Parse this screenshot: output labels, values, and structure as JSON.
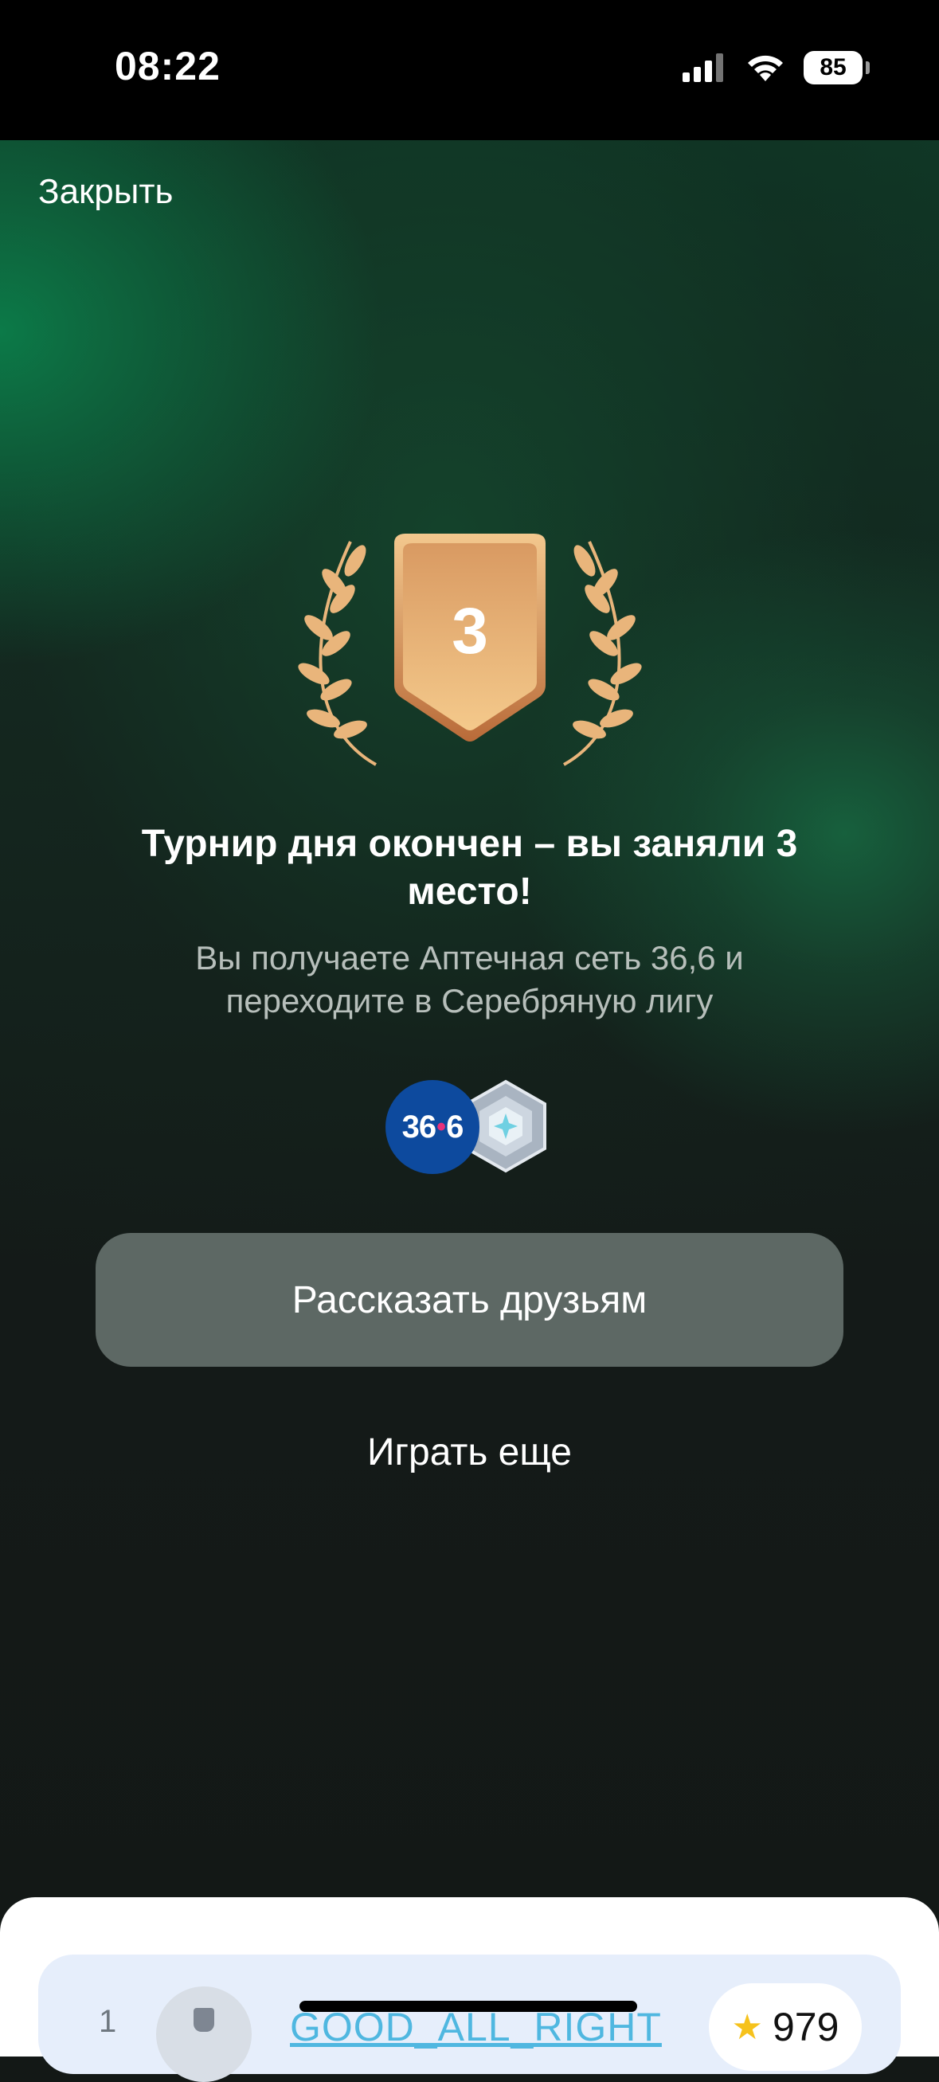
{
  "status_bar": {
    "time": "08:22",
    "battery": "85"
  },
  "header": {
    "close_label": "Закрыть"
  },
  "result": {
    "place": "3",
    "title": "Турнир дня окончен – вы заняли 3 место!",
    "subtitle": "Вы получаете Аптечная сеть 36,6 и переходите в Серебряную лигу"
  },
  "rewards": {
    "pharmacy_logo_left": "36",
    "pharmacy_logo_right": "6"
  },
  "actions": {
    "share_label": "Рассказать друзьям",
    "play_again_label": "Играть еще"
  },
  "leaderboard": {
    "rows": [
      {
        "rank": "1",
        "name": "GOOD_ALL_RIGHT",
        "score": "979"
      }
    ]
  },
  "colors": {
    "medal_bronze": "#e7a86a",
    "button_bg": "#5d6864",
    "accent_green": "#0c7a48",
    "row_bg": "#e6eefb"
  }
}
